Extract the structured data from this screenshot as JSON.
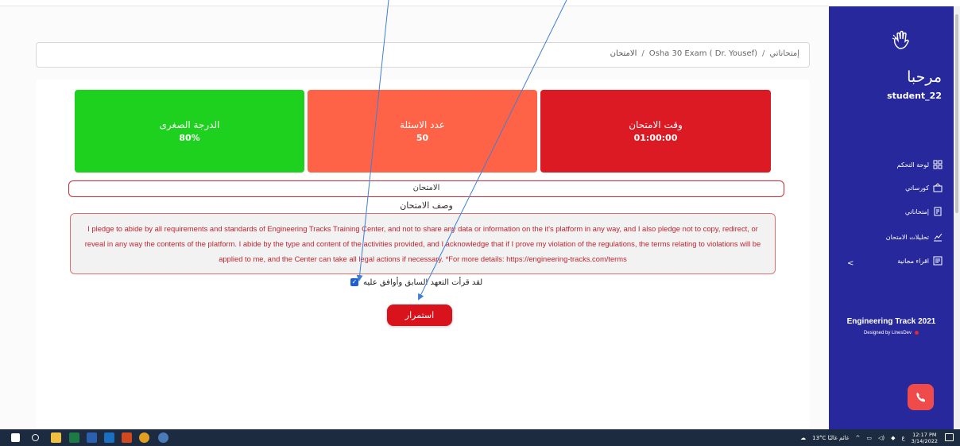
{
  "breadcrumb": {
    "home": "إمتحاناتي",
    "sep1": "/",
    "exam": "Osha 30 Exam ( Dr. Yousef)",
    "sep2": "/",
    "current": "الامتحان"
  },
  "stats": {
    "min_score": {
      "label": "الدرجة الصغرى",
      "value": "80%"
    },
    "questions": {
      "label": "عدد الاسئلة",
      "value": "50"
    },
    "duration": {
      "label": "وقت الامتحان",
      "value": "01:00:00"
    }
  },
  "exam": {
    "title": "الامتحان",
    "description_heading": "وصف الامتحان",
    "pledge_text": "I pledge to abide by all requirements and standards of Engineering Tracks Training Center, and not to share any data or information on the it's platform in any way, and I also pledge not to copy, redirect, or reveal in any way the contents of the platform. I abide by the type and content of the activities provided, and I acknowledge that if I prove my violation of the regulations, the terms relating to violations will be applied to me, and the Center can take all legal actions if necessary. *For more details: https://engineering-tracks.com/terms",
    "agree_label": "لقد قرأت التعهد السابق وأوافق عليه",
    "agree_checked": true,
    "continue_label": "استمرار"
  },
  "sidebar": {
    "greeting": "مرحبا",
    "username": "student_22",
    "items": [
      {
        "label": "لوحة التحكم",
        "icon": "dashboard-icon"
      },
      {
        "label": "كورساتي",
        "icon": "courses-icon"
      },
      {
        "label": "إمتحاناتي",
        "icon": "exams-icon"
      },
      {
        "label": "تحليلات الامتحان",
        "icon": "analytics-icon"
      },
      {
        "label": "اقراء مجانية",
        "icon": "free-read-icon"
      }
    ],
    "collapse": "<",
    "brand": "Engineering Track 2021",
    "designed_by": "Designed by LinesDev"
  },
  "taskbar": {
    "weather": "13°C غائم غالبًا",
    "lang": "ع",
    "time": "12:17 PM",
    "date": "3/14/2022"
  },
  "colors": {
    "sidebar": "#26289b",
    "green": "#1ed11e",
    "orange": "#ff6347",
    "red": "#db1a23",
    "accent": "#d8131c"
  }
}
